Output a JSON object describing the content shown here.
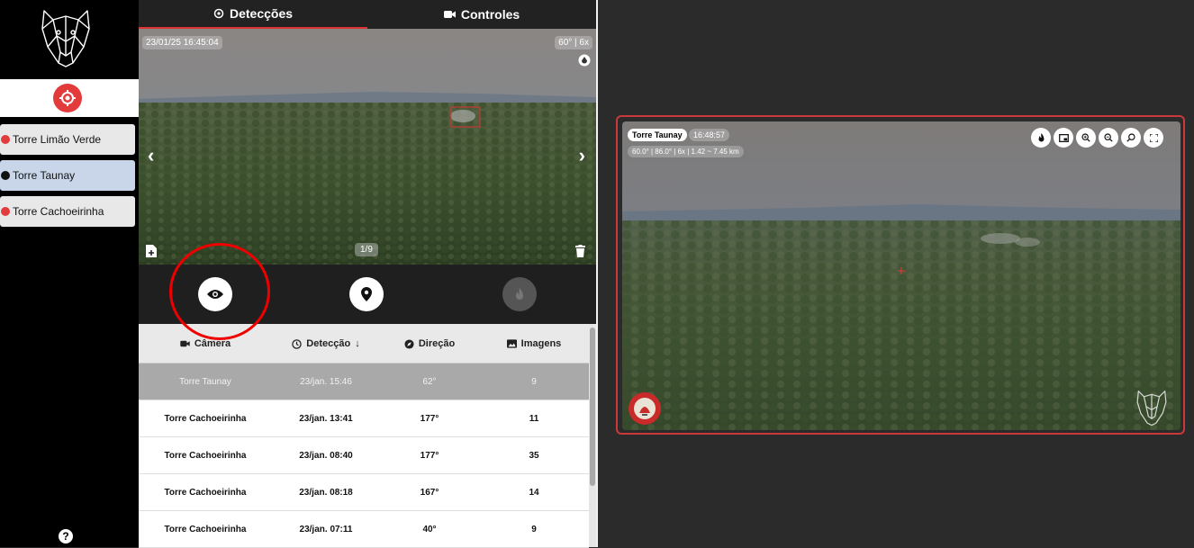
{
  "sidebar": {
    "towers": [
      {
        "label": "Torre Limão Verde",
        "status_color": "#e33b3b",
        "active": false
      },
      {
        "label": "Torre Taunay",
        "status_color": "#111111",
        "active": true
      },
      {
        "label": "Torre Cachoeirinha",
        "status_color": "#e33b3b",
        "active": false
      }
    ],
    "help_label": "?"
  },
  "tabs": {
    "detections_label": "Detecções",
    "controls_label": "Controles"
  },
  "detection_image": {
    "timestamp": "23/01/25 16:45:04",
    "fov_zoom": "60° | 6x",
    "counter": "1/9"
  },
  "table": {
    "headers": {
      "camera": "Câmera",
      "detection": "Detecção",
      "direction": "Direção",
      "images": "Imagens"
    },
    "rows": [
      {
        "camera": "Torre Taunay",
        "detection": "23/jan. 15:46",
        "direction": "62°",
        "images": "9"
      },
      {
        "camera": "Torre Cachoeirinha",
        "detection": "23/jan. 13:41",
        "direction": "177°",
        "images": "11"
      },
      {
        "camera": "Torre Cachoeirinha",
        "detection": "23/jan. 08:40",
        "direction": "177°",
        "images": "35"
      },
      {
        "camera": "Torre Cachoeirinha",
        "detection": "23/jan. 08:18",
        "direction": "167°",
        "images": "14"
      },
      {
        "camera": "Torre Cachoeirinha",
        "detection": "23/jan. 07:11",
        "direction": "40°",
        "images": "9"
      }
    ]
  },
  "camera_view": {
    "name": "Torre Taunay",
    "time": "16:48:57",
    "info": "60.0° | 86.0° | 6x | 1.42 ~ 7.45 km"
  },
  "colors": {
    "accent": "#e33b3b",
    "selected_row": "#a9a9a9",
    "active_tower": "#c9d6ea"
  }
}
